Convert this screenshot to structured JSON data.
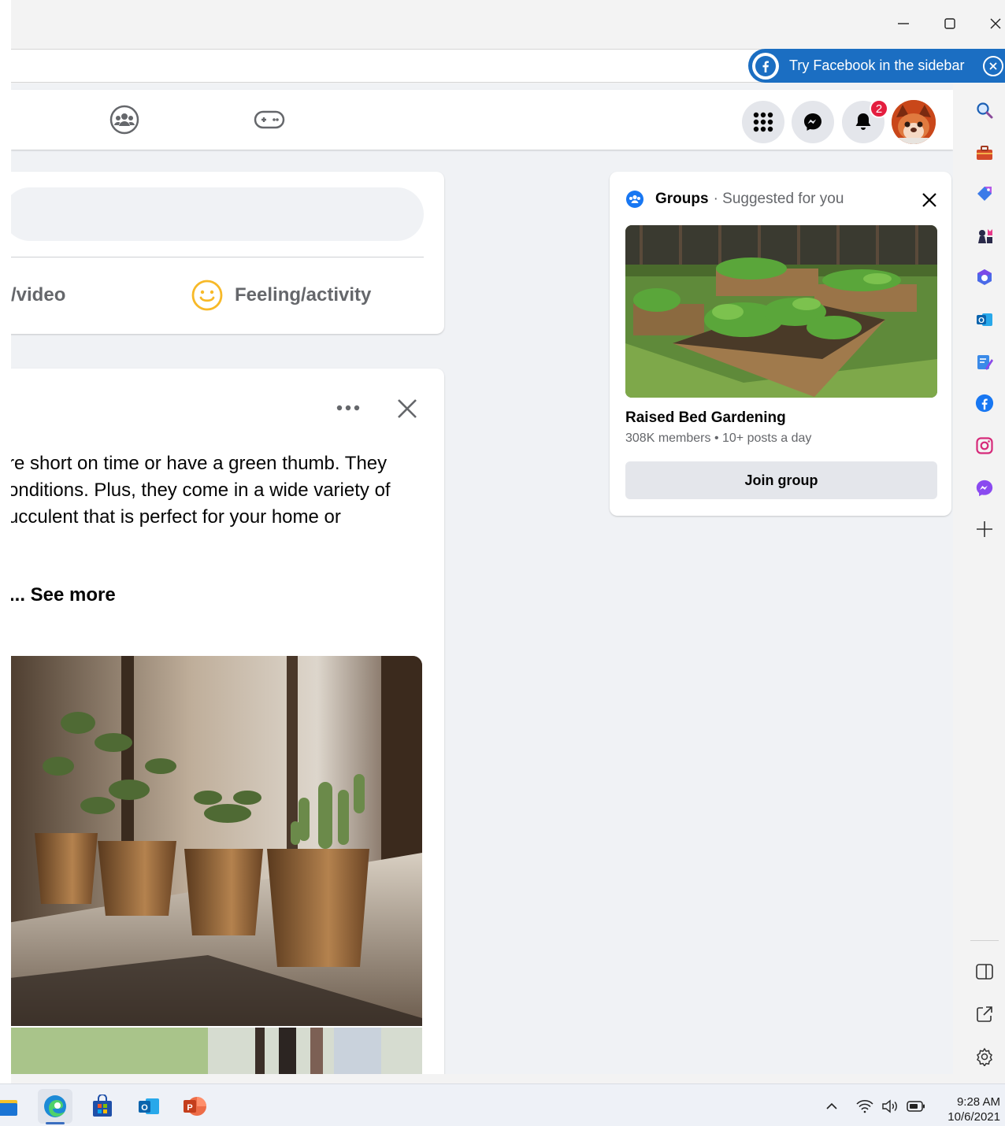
{
  "window": {
    "minimize_icon": "minimize-icon",
    "maximize_icon": "maximize-icon",
    "close_icon": "close-icon"
  },
  "banner": {
    "label": "Try Facebook in the sidebar"
  },
  "nav": {
    "notifications_count": "2"
  },
  "composer": {
    "photo_video_label": "/video",
    "feeling_label": "Feeling/activity"
  },
  "post": {
    "text": "re short on time or have a green thumb. They\nonditions. Plus, they come in a wide variety of\nucculent that is perfect for your home or",
    "see_more": "... See more"
  },
  "groups_card": {
    "heading": "Groups",
    "subheading": "· Suggested for you",
    "group_name": "Raised Bed Gardening",
    "group_meta": "308K members • 10+ posts a day",
    "join_label": "Join group"
  },
  "clock": {
    "time": "9:28 AM",
    "date": "10/6/2021"
  },
  "colors": {
    "facebook_blue": "#1b6ec2",
    "badge_red": "#e41e3f",
    "page_bg": "#f0f2f5"
  }
}
